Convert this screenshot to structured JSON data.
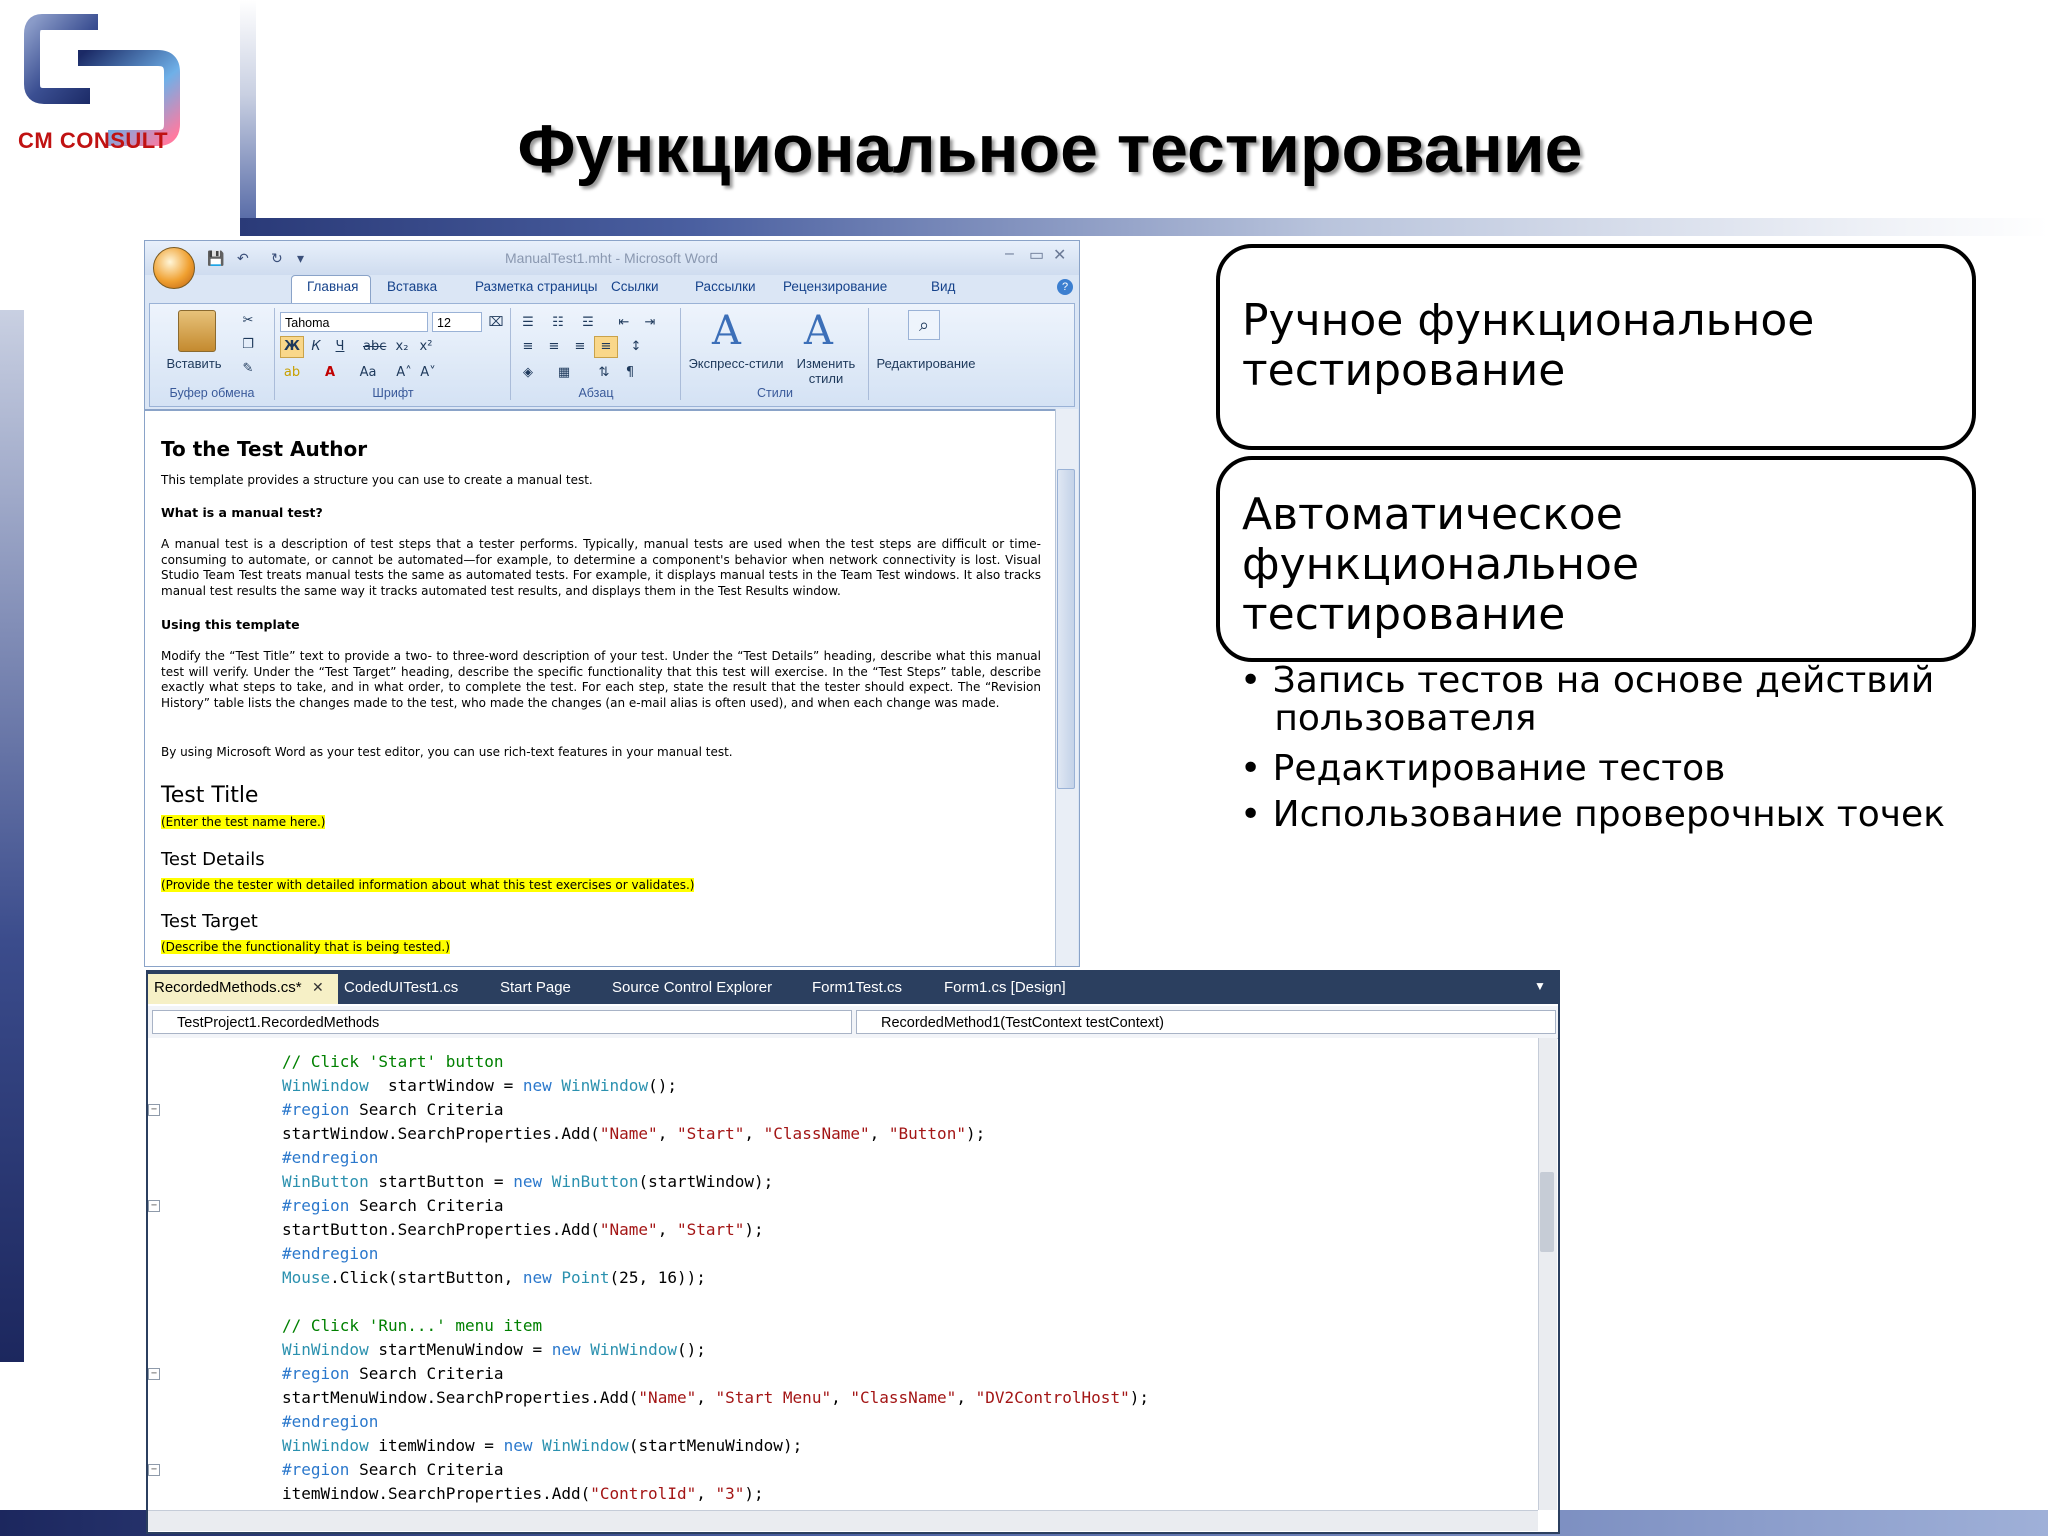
{
  "slide": {
    "title": "Функциональное тестирование",
    "logo_text": "CM CONSULT"
  },
  "word": {
    "window_title": "ManualTest1.mht - Microsoft Word",
    "tabs": [
      "Главная",
      "Вставка",
      "Разметка страницы",
      "Ссылки",
      "Рассылки",
      "Рецензирование",
      "Вид"
    ],
    "active_tab": "Главная",
    "groups": {
      "clipboard": "Буфер обмена",
      "font": "Шрифт",
      "paragraph": "Абзац",
      "styles": "Стили"
    },
    "paste_label": "Вставить",
    "font_name": "Tahoma",
    "font_size": "12",
    "express_styles": "Экспресс-стили",
    "change_styles_1": "Изменить",
    "change_styles_2": "стили",
    "editing": "Редактирование",
    "doc": {
      "heading": "To the Test Author",
      "intro": "This template provides a structure you can use to create a manual test.",
      "q1": "What is a manual test?",
      "p1": "A manual test is a description of test steps that a tester performs. Typically, manual tests are used when the test steps are difficult or time-consuming to automate, or cannot be automated—for example, to determine a component's behavior when network connectivity is lost. Visual Studio Team Test treats manual tests the same as automated tests. For example, it displays manual tests in the Team Test windows. It also tracks manual test results the same way it tracks automated test results, and displays them in the Test Results window.",
      "q2": "Using this template",
      "p2": "Modify the “Test Title” text to provide a two- to three-word description of your test. Under the “Test Details” heading, describe what this manual test will verify. Under the “Test Target” heading, describe the specific functionality that this test will exercise. In the “Test Steps” table, describe exactly what steps to take, and in what order, to complete the test. For each step, state the result that the tester should expect. The “Revision History” table lists the changes made to the test, who made the changes (an e-mail alias is often used), and when each change was made.",
      "p3": "By using Microsoft Word as your test editor, you can use rich-text features in your manual test.",
      "h_title": "Test Title",
      "t_title": "(Enter the test name here.)",
      "h_details": "Test Details",
      "t_details": "(Provide the tester with detailed information about what this test exercises or validates.)",
      "h_target": "Test Target",
      "t_target": "(Describe the functionality that is being tested.)"
    }
  },
  "callouts": {
    "manual": [
      "Ручное функциональное",
      "тестирование"
    ],
    "auto": [
      "Автоматическое",
      "функциональное",
      "тестирование"
    ]
  },
  "bullets": [
    [
      "• Запись тестов на основе действий",
      "   пользователя"
    ],
    [
      "• Редактирование тестов"
    ],
    [
      "• Использование проверочных точек"
    ]
  ],
  "vs": {
    "tabs": [
      "RecordedMethods.cs*",
      "CodedUITest1.cs",
      "Start Page",
      "Source Control Explorer",
      "Form1Test.cs",
      "Form1.cs [Design]"
    ],
    "class_nav": "TestProject1.RecordedMethods",
    "method_nav": "RecordedMethod1(TestContext testContext)",
    "code_lines": [
      [
        [
          "cm",
          "// Click 'Start' button"
        ]
      ],
      [
        [
          "ty",
          "WinWindow"
        ],
        [
          "",
          "  startWindow = "
        ],
        [
          "kw",
          "new"
        ],
        [
          "",
          " "
        ],
        [
          "ty",
          "WinWindow"
        ],
        [
          "",
          "();"
        ]
      ],
      [
        [
          "kw",
          "#region"
        ],
        [
          "",
          " Search Criteria"
        ]
      ],
      [
        [
          "",
          "startWindow.SearchProperties.Add("
        ],
        [
          "st",
          "\"Name\""
        ],
        [
          "",
          ", "
        ],
        [
          "st",
          "\"Start\""
        ],
        [
          "",
          ", "
        ],
        [
          "st",
          "\"ClassName\""
        ],
        [
          "",
          ", "
        ],
        [
          "st",
          "\"Button\""
        ],
        [
          "",
          ");"
        ]
      ],
      [
        [
          "kw",
          "#endregion"
        ]
      ],
      [
        [
          "ty",
          "WinButton"
        ],
        [
          "",
          " startButton = "
        ],
        [
          "kw",
          "new"
        ],
        [
          "",
          " "
        ],
        [
          "ty",
          "WinButton"
        ],
        [
          "",
          "(startWindow);"
        ]
      ],
      [
        [
          "kw",
          "#region"
        ],
        [
          "",
          " Search Criteria"
        ]
      ],
      [
        [
          "",
          "startButton.SearchProperties.Add("
        ],
        [
          "st",
          "\"Name\""
        ],
        [
          "",
          ", "
        ],
        [
          "st",
          "\"Start\""
        ],
        [
          "",
          ");"
        ]
      ],
      [
        [
          "kw",
          "#endregion"
        ]
      ],
      [
        [
          "ty",
          "Mouse"
        ],
        [
          "",
          ".Click(startButton, "
        ],
        [
          "kw",
          "new"
        ],
        [
          "",
          " "
        ],
        [
          "ty",
          "Point"
        ],
        [
          "",
          "(25, 16));"
        ]
      ],
      [
        [
          "",
          ""
        ]
      ],
      [
        [
          "cm",
          "// Click 'Run...' menu item"
        ]
      ],
      [
        [
          "ty",
          "WinWindow"
        ],
        [
          "",
          " startMenuWindow = "
        ],
        [
          "kw",
          "new"
        ],
        [
          "",
          " "
        ],
        [
          "ty",
          "WinWindow"
        ],
        [
          "",
          "();"
        ]
      ],
      [
        [
          "kw",
          "#region"
        ],
        [
          "",
          " Search Criteria"
        ]
      ],
      [
        [
          "",
          "startMenuWindow.SearchProperties.Add("
        ],
        [
          "st",
          "\"Name\""
        ],
        [
          "",
          ", "
        ],
        [
          "st",
          "\"Start Menu\""
        ],
        [
          "",
          ", "
        ],
        [
          "st",
          "\"ClassName\""
        ],
        [
          "",
          ", "
        ],
        [
          "st",
          "\"DV2ControlHost\""
        ],
        [
          "",
          ");"
        ]
      ],
      [
        [
          "kw",
          "#endregion"
        ]
      ],
      [
        [
          "ty",
          "WinWindow"
        ],
        [
          "",
          " itemWindow = "
        ],
        [
          "kw",
          "new"
        ],
        [
          "",
          " "
        ],
        [
          "ty",
          "WinWindow"
        ],
        [
          "",
          "(startMenuWindow);"
        ]
      ],
      [
        [
          "kw",
          "#region"
        ],
        [
          "",
          " Search Criteria"
        ]
      ],
      [
        [
          "",
          "itemWindow.SearchProperties.Add("
        ],
        [
          "st",
          "\"ControlId\""
        ],
        [
          "",
          ", "
        ],
        [
          "st",
          "\"3\""
        ],
        [
          "",
          ");"
        ]
      ]
    ]
  },
  "colors": {
    "keyword": "#2b78cc",
    "type": "#2b91af",
    "string": "#a31515",
    "comment": "#008000",
    "highlight": "#ffff00",
    "logo_red": "#c01212"
  }
}
